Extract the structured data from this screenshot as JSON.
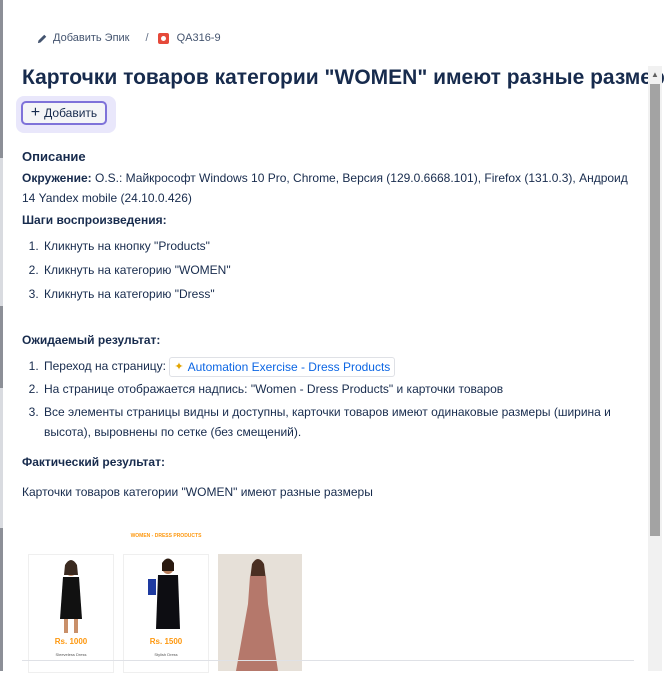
{
  "breadcrumb": {
    "add_epic": "Добавить Эпик",
    "separator": "/",
    "issue_key": "QA316-9"
  },
  "issue": {
    "title": "Карточки товаров категории \"WOMEN\" имеют разные размеры",
    "add_button": "Добавить"
  },
  "description": {
    "heading": "Описание",
    "environment_label": "Окружение:",
    "environment_text": " O.S.: Майкрософт Windows 10 Pro, Chrome, Версия (129.0.6668.101), Firefox (131.0.3), Андроид 14 Yandex mobile (24.10.0.426)",
    "steps_heading": "Шаги воспроизведения:",
    "steps": [
      "Кликнуть на кнопку \"Products\"",
      "Кликнуть на категорию \"WOMEN\"",
      "Кликнуть на категорию \"Dress\""
    ],
    "expected_heading": "Ожидаемый результат:",
    "expected": {
      "item1_prefix": "Переход на страницу: ",
      "item1_link": "Automation Exercise - Dress Products",
      "item2": "На странице отображается надпись: \"Women - Dress Products\" и карточки товаров",
      "item3": "Все элементы страницы видны и доступны, карточки товаров имеют одинаковые размеры (ширина и высота), выровнены по сетке (без смещений)."
    },
    "actual_heading": "Фактический результат:",
    "actual_text": "Карточки товаров категории \"WOMEN\" имеют разные размеры"
  },
  "screenshot": {
    "banner": "WOMEN - DRESS PRODUCTS",
    "products": [
      {
        "price": "Rs. 1000",
        "name": "Sleeveless Dress"
      },
      {
        "price": "Rs. 1500",
        "name": "Stylish Dress"
      }
    ]
  },
  "icons": {
    "edit": "pencil-icon",
    "issue_type": "bug-icon",
    "link_favicon": "sparkle-icon",
    "scroll_up": "chevron-up-icon"
  },
  "colors": {
    "title": "#172b4d",
    "link": "#0c66e4",
    "button_border": "#7e72d9",
    "bug": "#e5493a",
    "price": "#fe980f"
  }
}
